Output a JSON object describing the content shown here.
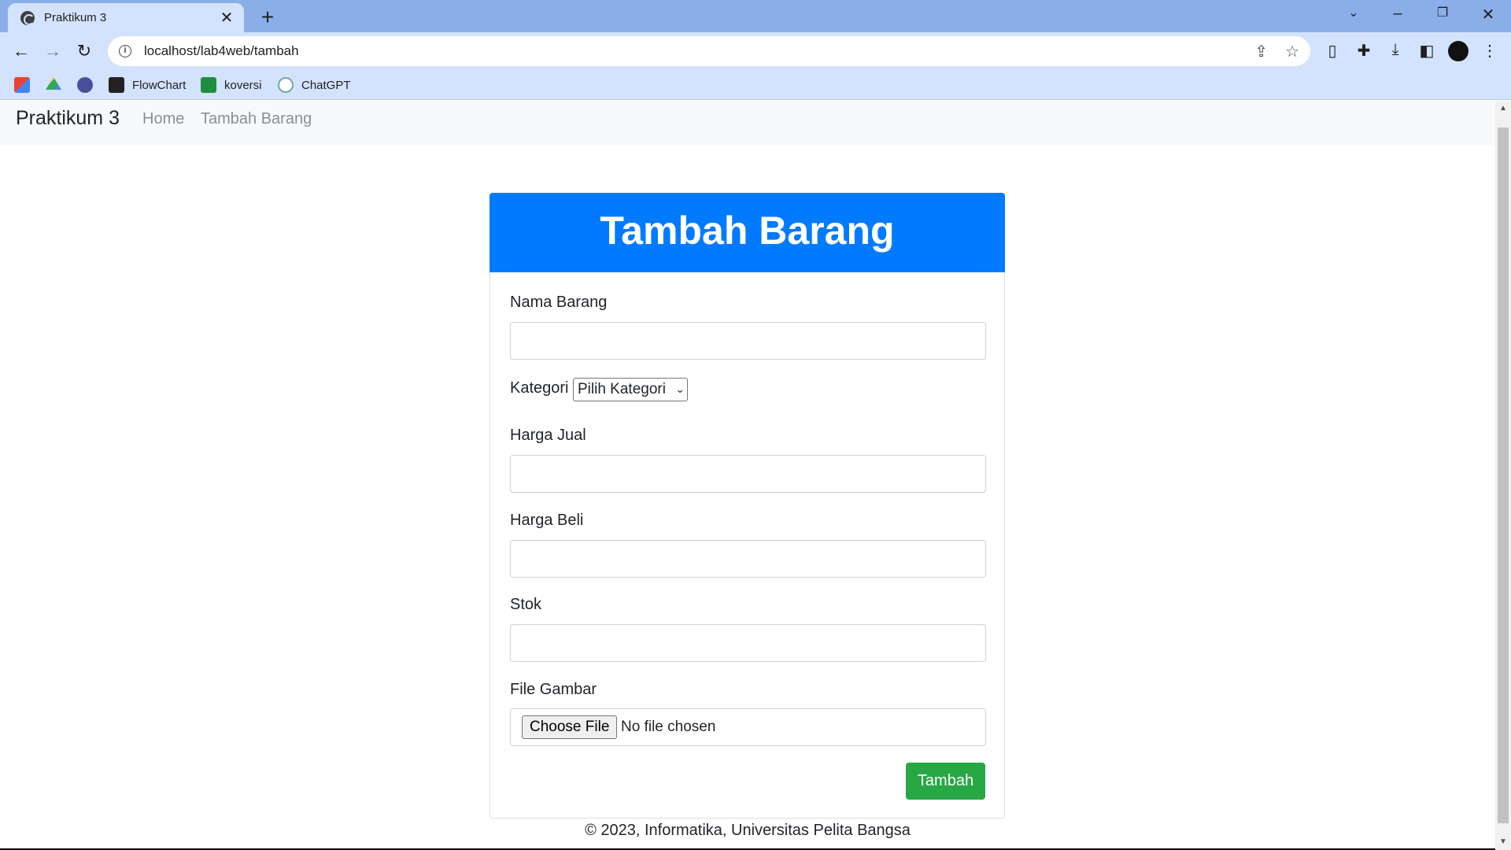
{
  "browser": {
    "tab_title": "Praktikum 3",
    "tab_close": "✕",
    "new_tab": "+",
    "url": "localhost/lab4web/tambah",
    "bookmarks": [
      "FlowChart",
      "koversi",
      "ChatGPT"
    ]
  },
  "navbar": {
    "brand": "Praktikum 3",
    "links": [
      "Home",
      "Tambah Barang"
    ]
  },
  "form": {
    "title": "Tambah Barang",
    "fields": {
      "nama_barang_label": "Nama Barang",
      "nama_barang_value": "",
      "kategori_label": "Kategori",
      "kategori_selected": "Pilih Kategori",
      "harga_jual_label": "Harga Jual",
      "harga_jual_value": "",
      "harga_beli_label": "Harga Beli",
      "harga_beli_value": "",
      "stok_label": "Stok",
      "stok_value": "",
      "file_gambar_label": "File Gambar",
      "file_button": "Choose File",
      "file_status": "No file chosen"
    },
    "submit_label": "Tambah"
  },
  "footer": {
    "text": "© 2023, Informatika, Universitas Pelita Bangsa"
  },
  "colors": {
    "header_bg": "#007bff",
    "submit_bg": "#28a745",
    "navbar_bg": "#f8f9fa"
  }
}
